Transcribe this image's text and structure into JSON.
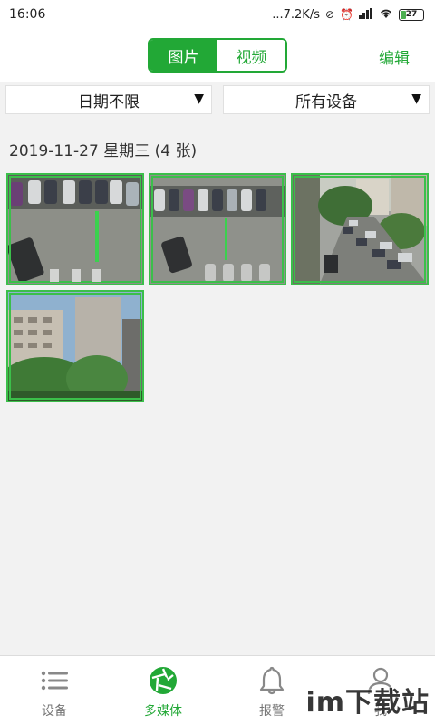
{
  "status_bar": {
    "time": "16:06",
    "network_speed": "...7.2K/s",
    "battery_level": "27"
  },
  "header": {
    "tabs": [
      {
        "label": "图片",
        "active": true
      },
      {
        "label": "视频",
        "active": false
      }
    ],
    "edit_label": "编辑"
  },
  "filters": {
    "date": {
      "selected": "日期不限"
    },
    "device": {
      "selected": "所有设备"
    }
  },
  "gallery": {
    "groups": [
      {
        "title": "2019-11-27  星期三  (4 张)",
        "items": [
          {
            "name": "photo-1"
          },
          {
            "name": "photo-2"
          },
          {
            "name": "photo-3"
          },
          {
            "name": "photo-4"
          }
        ]
      }
    ]
  },
  "bottom_nav": {
    "items": [
      {
        "label": "设备",
        "icon": "list-icon",
        "active": false
      },
      {
        "label": "多媒体",
        "icon": "camera-aperture-icon",
        "active": true
      },
      {
        "label": "报警",
        "icon": "bell-icon",
        "active": false
      },
      {
        "label": "我",
        "icon": "person-icon",
        "active": false
      }
    ]
  },
  "watermark": "im下载站",
  "colors": {
    "accent": "#22a836",
    "background": "#f2f2f2"
  }
}
